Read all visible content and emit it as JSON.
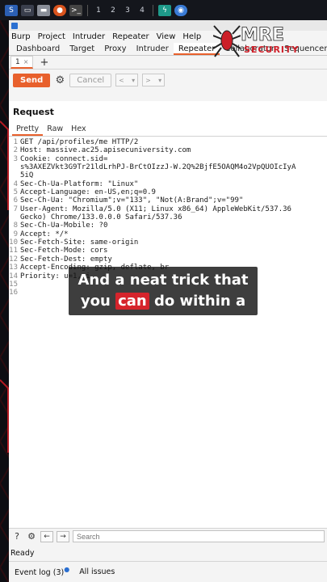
{
  "taskbar": {
    "workspaces": [
      "1",
      "2",
      "3",
      "4"
    ]
  },
  "menu": [
    "Burp",
    "Project",
    "Intruder",
    "Repeater",
    "View",
    "Help"
  ],
  "tabs": [
    "Dashboard",
    "Target",
    "Proxy",
    "Intruder",
    "Repeater",
    "Collaborator",
    "Sequencer"
  ],
  "active_tab": "Repeater",
  "subtab": {
    "label": "1",
    "close": "×"
  },
  "toolbar": {
    "send_label": "Send",
    "cancel_label": "Cancel"
  },
  "request": {
    "title": "Request",
    "view_tabs": [
      "Pretty",
      "Raw",
      "Hex"
    ],
    "lines": [
      {
        "n": "1",
        "t": "GET /api/profiles/me HTTP/2"
      },
      {
        "n": "2",
        "t": "Host: massive.ac25.apisecuniversity.com"
      },
      {
        "n": "3",
        "t": "Cookie: connect.sid="
      },
      {
        "n": "",
        "t": "s%3AXEZVkt3G9Tr21ldLrhPJ-BrCtOIzzJ-W.2Q%2BjfE5OAQM4o2VpQUOIcIyA"
      },
      {
        "n": "",
        "t": "5iQ"
      },
      {
        "n": "4",
        "t": "Sec-Ch-Ua-Platform: \"Linux\""
      },
      {
        "n": "5",
        "t": "Accept-Language: en-US,en;q=0.9"
      },
      {
        "n": "6",
        "t": "Sec-Ch-Ua: \"Chromium\";v=\"133\", \"Not(A:Brand\";v=\"99\""
      },
      {
        "n": "7",
        "t": "User-Agent: Mozilla/5.0 (X11; Linux x86_64) AppleWebKit/537.36"
      },
      {
        "n": "",
        "t": "Gecko) Chrome/133.0.0.0 Safari/537.36"
      },
      {
        "n": "8",
        "t": "Sec-Ch-Ua-Mobile: ?0"
      },
      {
        "n": "9",
        "t": "Accept: */*"
      },
      {
        "n": "10",
        "t": "Sec-Fetch-Site: same-origin"
      },
      {
        "n": "11",
        "t": "Sec-Fetch-Mode: cors"
      },
      {
        "n": "12",
        "t": "Sec-Fetch-Dest: empty"
      },
      {
        "n": "13",
        "t": "Accept-Encoding: gzip, deflate, br"
      },
      {
        "n": "14",
        "t": "Priority: u=1, i"
      },
      {
        "n": "15",
        "t": ""
      },
      {
        "n": "16",
        "t": ""
      }
    ]
  },
  "caption": {
    "line1": "And a neat trick that",
    "line2_pre": "you ",
    "line2_hl": "can",
    "line2_post": " do within a"
  },
  "bottom": {
    "search_placeholder": "Search"
  },
  "status": "Ready",
  "footer": {
    "event_log": "Event log (3)",
    "all_issues": "All issues"
  },
  "watermark": {
    "text": "MRE",
    "sub": "SECURITY"
  },
  "colors": {
    "accent": "#e8602c",
    "caption_highlight": "#d6242c",
    "watermark_red": "#d0202a"
  }
}
